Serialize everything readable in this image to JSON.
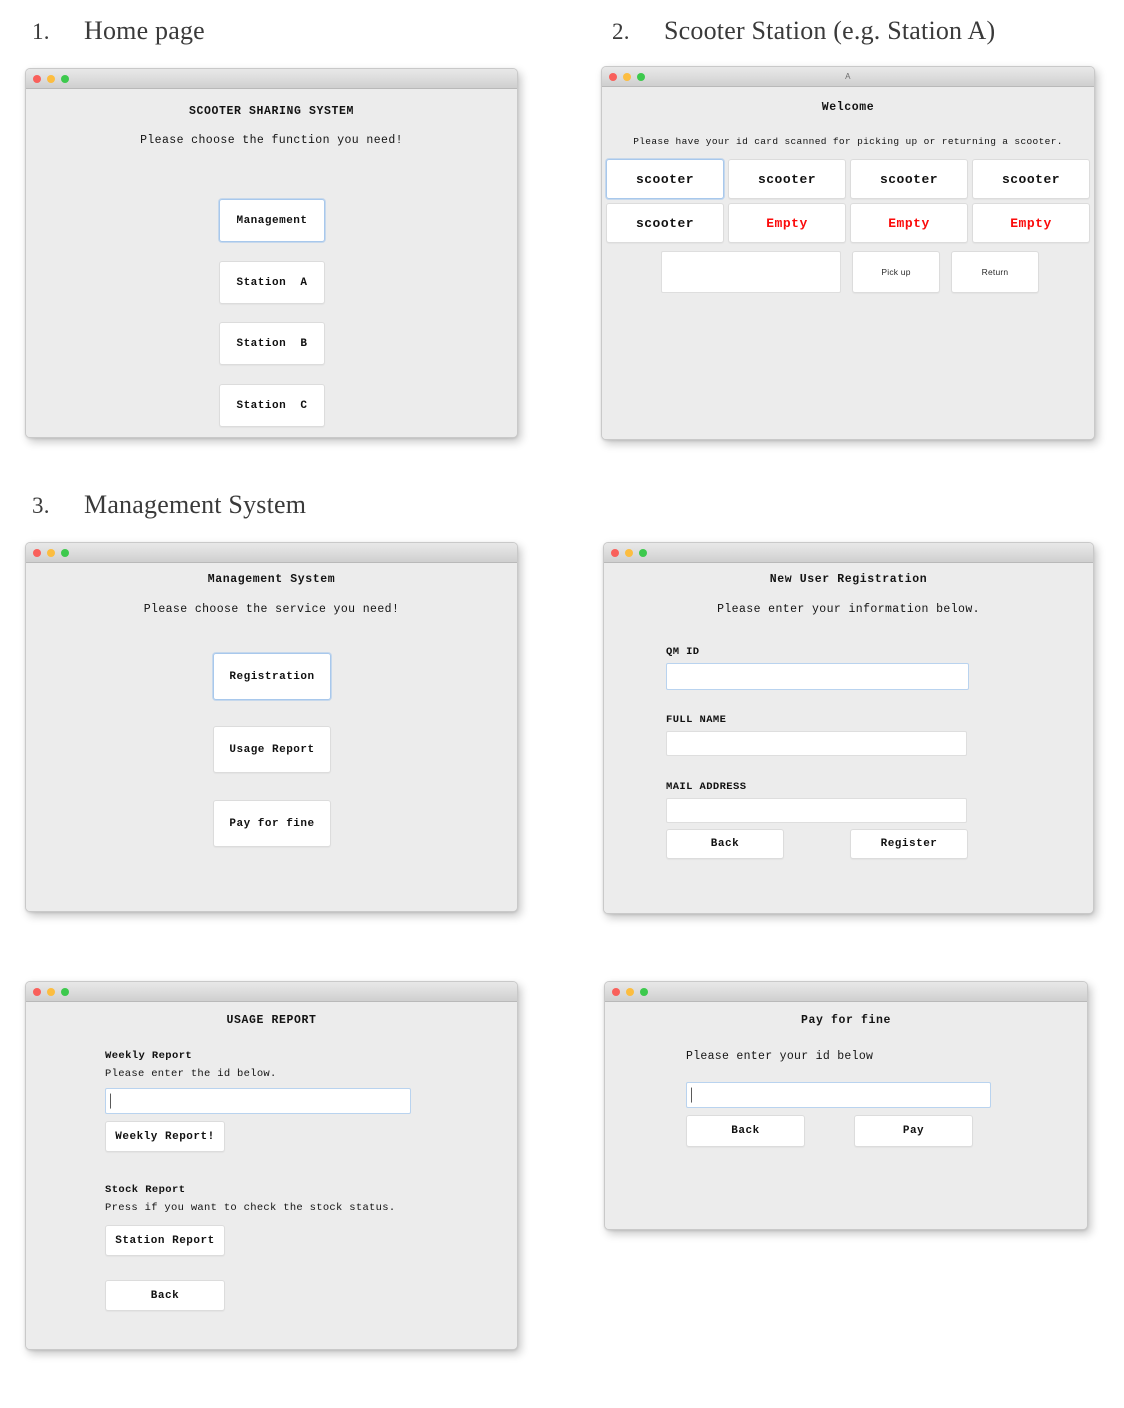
{
  "sections": [
    {
      "number": "1.",
      "title": "Home page"
    },
    {
      "number": "2.",
      "title": "Scooter Station (e.g. Station A)"
    },
    {
      "number": "3.",
      "title": "Management System"
    }
  ],
  "home_window": {
    "window_title": "",
    "heading": "SCOOTER SHARING SYSTEM",
    "subheading": "Please choose the function you need!",
    "buttons": [
      {
        "label": "Management",
        "focused": true
      },
      {
        "label": "Station  A",
        "focused": false
      },
      {
        "label": "Station  B",
        "focused": false
      },
      {
        "label": "Station  C",
        "focused": false
      }
    ]
  },
  "station_window": {
    "window_title": "A",
    "heading": "Welcome",
    "subheading": "Please have your id card scanned for picking up or returning a scooter.",
    "slots": [
      {
        "label": "scooter",
        "state": "occupied",
        "focused": true
      },
      {
        "label": "scooter",
        "state": "occupied",
        "focused": false
      },
      {
        "label": "scooter",
        "state": "occupied",
        "focused": false
      },
      {
        "label": "scooter",
        "state": "occupied",
        "focused": false
      },
      {
        "label": "scooter",
        "state": "occupied",
        "focused": false
      },
      {
        "label": "Empty",
        "state": "empty",
        "focused": false
      },
      {
        "label": "Empty",
        "state": "empty",
        "focused": false
      },
      {
        "label": "Empty",
        "state": "empty",
        "focused": false
      }
    ],
    "id_input": {
      "value": "",
      "placeholder": ""
    },
    "pick_up_label": "Pick up",
    "return_label": "Return"
  },
  "management_window": {
    "window_title": "",
    "heading": "Management System",
    "subheading": "Please choose the service you need!",
    "buttons": [
      {
        "label": "Registration",
        "focused": true
      },
      {
        "label": "Usage Report",
        "focused": false
      },
      {
        "label": "Pay for fine",
        "focused": false
      }
    ]
  },
  "registration_window": {
    "window_title": "",
    "heading": "New User Registration",
    "subheading": "Please enter your information below.",
    "fields": [
      {
        "label": "QM ID",
        "value": "",
        "placeholder": "",
        "focused": true
      },
      {
        "label": "FULL NAME",
        "value": "",
        "placeholder": "",
        "focused": false
      },
      {
        "label": "MAIL ADDRESS",
        "value": "",
        "placeholder": "",
        "focused": false
      }
    ],
    "back_label": "Back",
    "register_label": "Register"
  },
  "usage_report_window": {
    "window_title": "",
    "heading": "USAGE REPORT",
    "weekly": {
      "section_label": "Weekly Report",
      "instruction": "Please enter the id below.",
      "input": {
        "value": "",
        "placeholder": ""
      },
      "button_label": "Weekly Report!"
    },
    "stock": {
      "section_label": "Stock Report",
      "instruction": "Press if you want to check the stock status.",
      "button_label": "Station Report"
    },
    "back_label": "Back"
  },
  "pay_fine_window": {
    "window_title": "",
    "heading": "Pay for fine",
    "instruction": "Please enter your id below",
    "input": {
      "value": "",
      "placeholder": ""
    },
    "back_label": "Back",
    "pay_label": "Pay"
  },
  "colors": {
    "window_bg": "#ececec",
    "button_bg": "#ffffff",
    "empty_text": "#fb0b0b",
    "focus_border": "#a8c8ec",
    "heading_text": "#3a3a3a",
    "light_red": "#f9605b",
    "light_yellow": "#fcbd40",
    "light_green": "#3dc94d"
  }
}
